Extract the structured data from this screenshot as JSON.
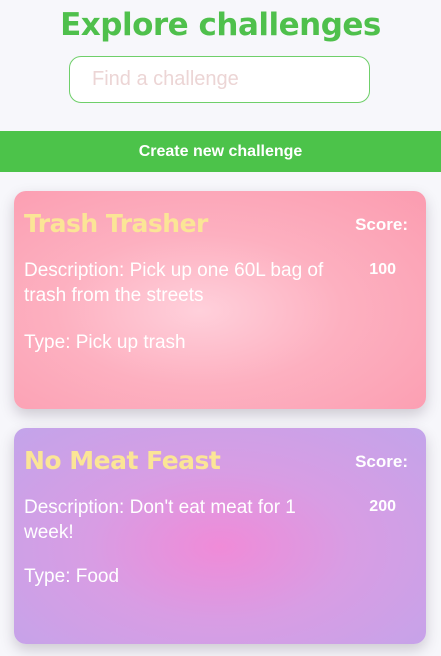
{
  "header": {
    "title": "Explore challenges"
  },
  "search": {
    "placeholder": "Find a challenge",
    "value": ""
  },
  "create_button": {
    "label": "Create new challenge"
  },
  "challenges": [
    {
      "title": "Trash Trasher",
      "description": "Description: Pick up one 60L bag of trash from the streets",
      "type": "Type: Pick up trash",
      "score_label": "Score:",
      "score": "100"
    },
    {
      "title": "No Meat Feast",
      "description": "Description: Don't eat meat for 1 week!",
      "type": "Type: Food",
      "score_label": "Score:",
      "score": "200"
    }
  ],
  "colors": {
    "accent_green": "#4cc34a",
    "title_green": "#4fc04c",
    "card_title_yellow": "#fbe596",
    "card_1_pink": "#fb9cb0",
    "card_2_purple": "#c3a4ea"
  }
}
